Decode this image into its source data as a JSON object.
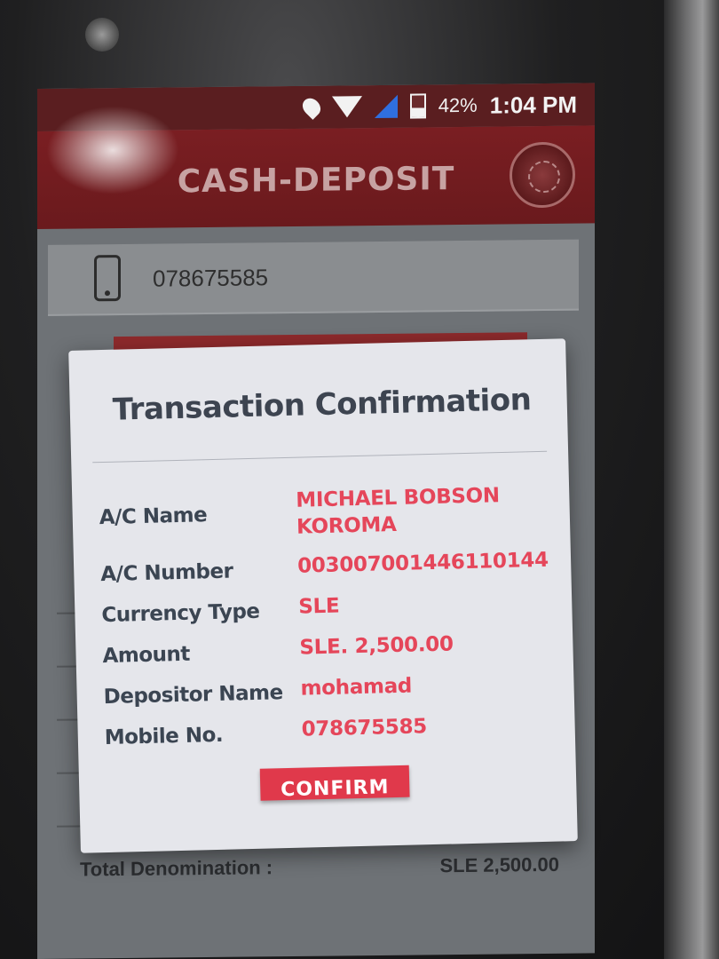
{
  "status_bar": {
    "battery_percent": "42%",
    "time": "1:04 PM",
    "icons": [
      "location-icon",
      "wifi-icon",
      "signal-icon",
      "battery-icon"
    ]
  },
  "app_bar": {
    "title": "CASH-DEPOSIT",
    "logo": "bank-logo-icon",
    "color": "#7a1e22"
  },
  "form": {
    "phone_value": "078675585",
    "total_label": "Total Denomination :",
    "total_value": "SLE 2,500.00"
  },
  "dialog": {
    "title": "Transaction Confirmation",
    "rows": [
      {
        "label": "A/C Name",
        "value": "MICHAEL BOBSON KOROMA"
      },
      {
        "label": "A/C Number",
        "value": "003007001446110144"
      },
      {
        "label": "Currency Type",
        "value": "SLE"
      },
      {
        "label": "Amount",
        "value": "SLE. 2,500.00"
      },
      {
        "label": "Depositor Name",
        "value": "mohamad"
      },
      {
        "label": "Mobile No.",
        "value": "078675585"
      }
    ],
    "confirm_label": "CONFIRM",
    "accent_color": "#e5465a"
  }
}
